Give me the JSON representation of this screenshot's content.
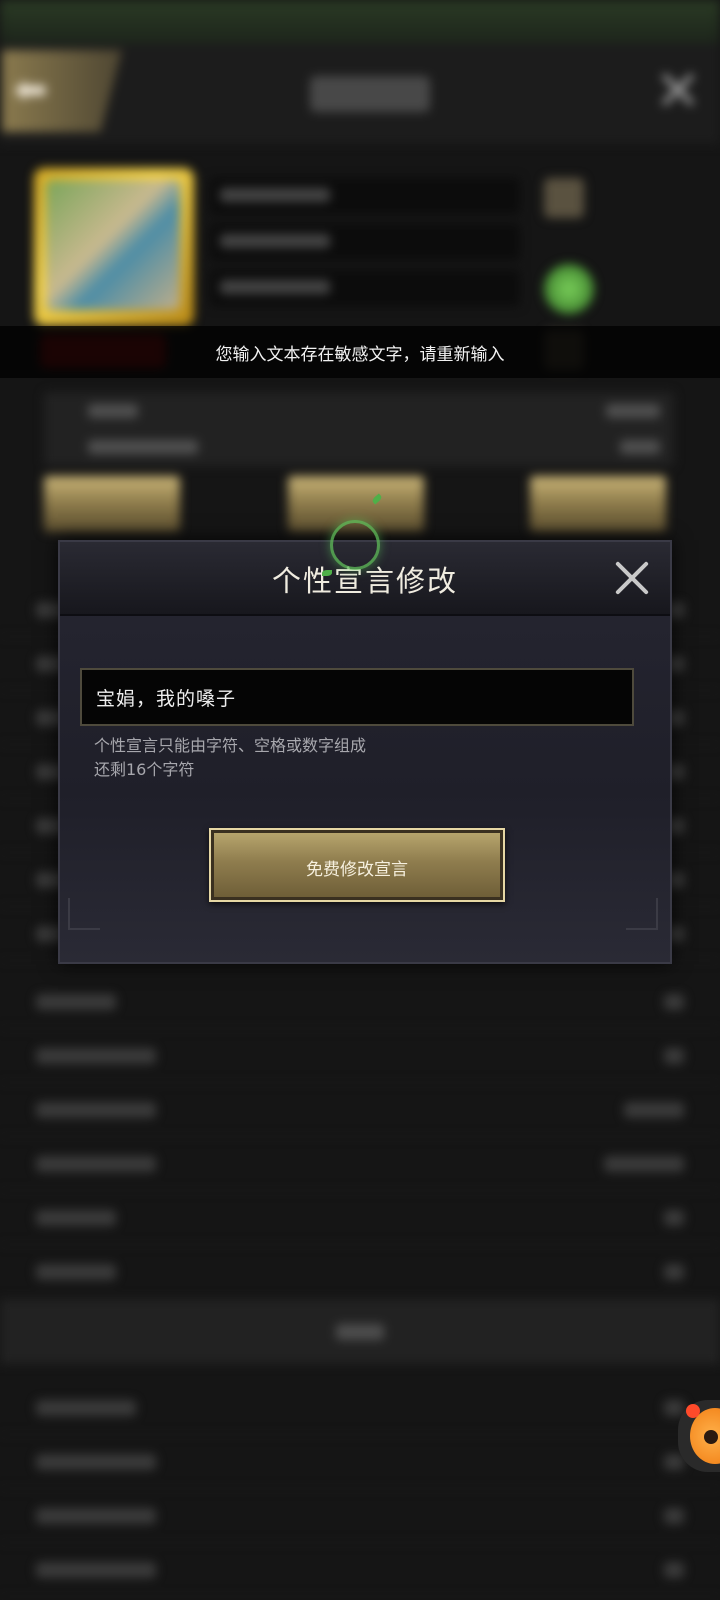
{
  "toast": {
    "message": "您输入文本存在敏感文字，请重新输入"
  },
  "dialog": {
    "title": "个性宣言修改",
    "input_value": "宝娟，我的嗓子",
    "hint_rule": "个性宣言只能由字符、空格或数字组成",
    "hint_remaining": "还剩16个字符",
    "confirm_label": "免费修改宣言"
  },
  "icons": {
    "back": "back-arrow-icon",
    "close": "close-icon",
    "dialog_close": "close-icon",
    "assistant": "assistant-mascot-icon"
  },
  "colors": {
    "page_bg": "#151515",
    "dialog_bg": "#23232d",
    "gold_button": "#8f7d4e",
    "toast_text": "#f2f2f2"
  }
}
